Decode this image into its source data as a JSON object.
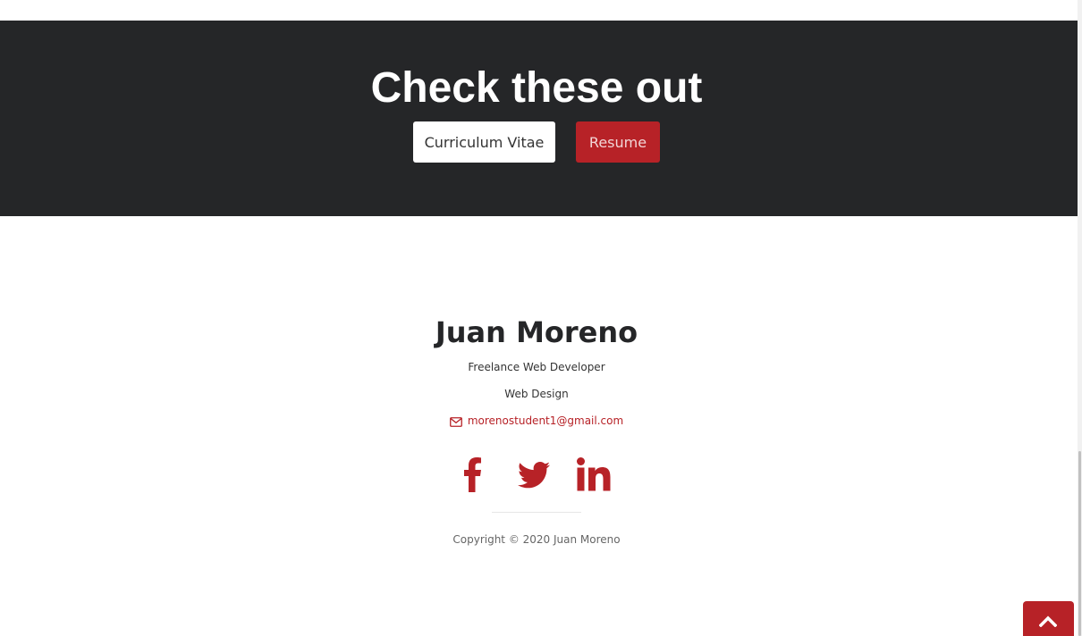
{
  "cta": {
    "title": "Check these out",
    "buttons": {
      "cv_label": "Curriculum Vitae",
      "resume_label": "Resume"
    }
  },
  "footer": {
    "name": "Juan Moreno",
    "roles": [
      "Freelance Web Developer",
      "Web Design"
    ],
    "email": "morenostudent1@gmail.com",
    "social_icons": [
      "facebook-icon",
      "twitter-icon",
      "linkedin-icon"
    ],
    "copyright": "Copyright © 2020 Juan Moreno"
  },
  "colors": {
    "accent": "#b72227",
    "band": "#252628",
    "text_dark": "#252628"
  },
  "scroll_to_top_icon": "chevron-up-icon"
}
